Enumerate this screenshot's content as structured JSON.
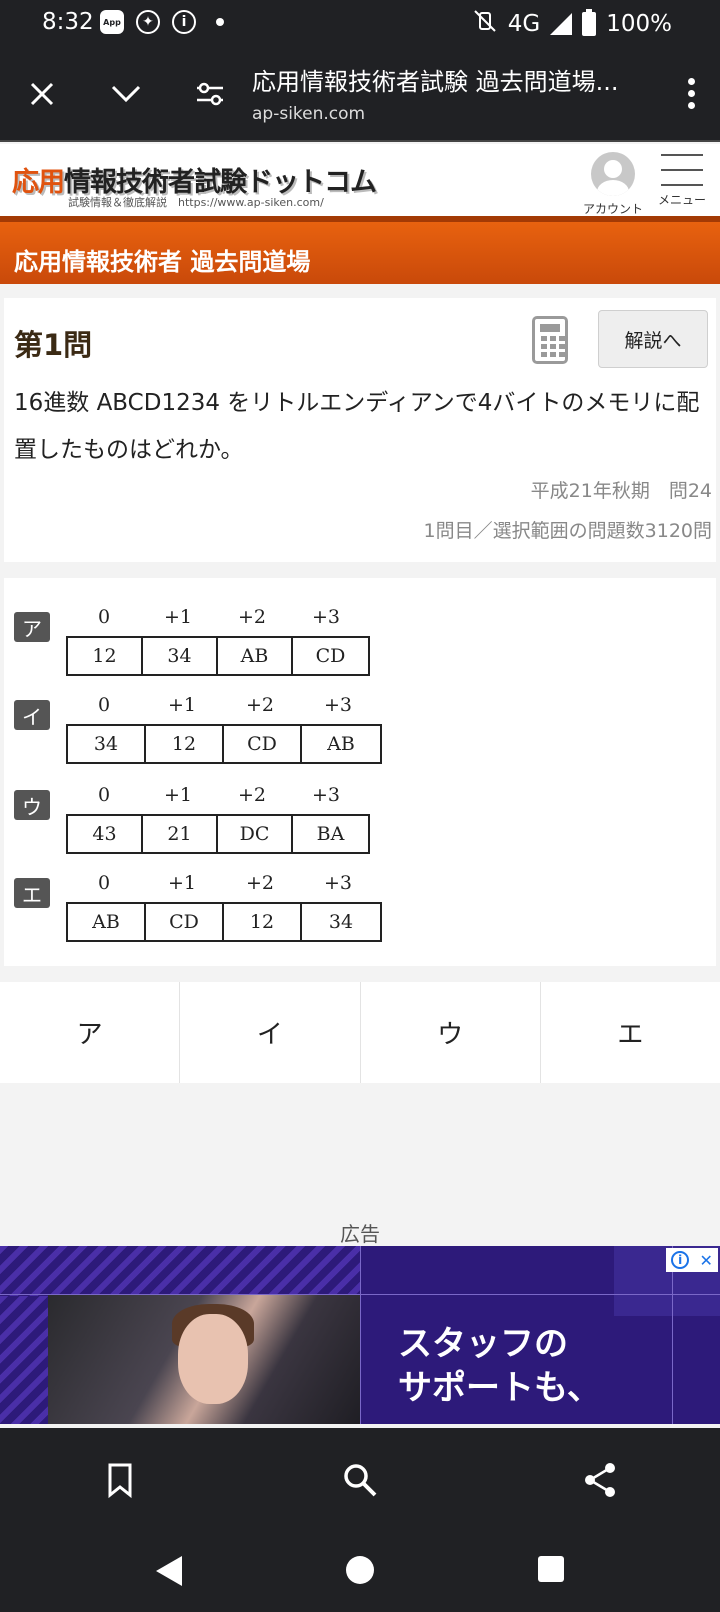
{
  "status_bar": {
    "time": "8:32",
    "app_badge": "App",
    "info_glyph": "i",
    "network": "4G",
    "battery": "100%",
    "icons": [
      "app-icon",
      "game-controller-icon",
      "info-icon",
      "notification-dot-icon",
      "vibrate-off-icon",
      "signal-icon",
      "battery-icon"
    ]
  },
  "browser": {
    "page_title": "応用情報技術者試験 過去問道場...",
    "url": "ap-siken.com",
    "icons": [
      "close-icon",
      "chevron-down-icon",
      "page-settings-icon",
      "more-vert-icon"
    ]
  },
  "site_header": {
    "logo_accent": "応用",
    "logo_rest": "情報技術者試験ドットコム",
    "logo_sub": "試験情報＆徹底解説　https://www.ap-siken.com/",
    "account_label": "アカウント",
    "menu_label": "メニュー"
  },
  "section_title": "応用情報技術者 過去問道場",
  "question": {
    "number": "第1問",
    "explain_button": "解説へ",
    "text": "16進数 ABCD1234 をリトルエンディアンで4バイトのメモリに配置したものはどれか。",
    "source": "平成21年秋期　問24",
    "progress": "1問目／選択範囲の問題数3120問"
  },
  "options": [
    {
      "label": "ア",
      "offsets": [
        "0",
        "+1",
        "+2",
        "+3"
      ],
      "cells": [
        "12",
        "34",
        "AB",
        "CD"
      ]
    },
    {
      "label": "イ",
      "offsets": [
        "0",
        "+1",
        "+2",
        "+3"
      ],
      "cells": [
        "34",
        "12",
        "CD",
        "AB"
      ]
    },
    {
      "label": "ウ",
      "offsets": [
        "0",
        "+1",
        "+2",
        "+3"
      ],
      "cells": [
        "43",
        "21",
        "DC",
        "BA"
      ]
    },
    {
      "label": "エ",
      "offsets": [
        "0",
        "+1",
        "+2",
        "+3"
      ],
      "cells": [
        "AB",
        "CD",
        "12",
        "34"
      ]
    }
  ],
  "answers": [
    "ア",
    "イ",
    "ウ",
    "エ"
  ],
  "ad": {
    "label": "広告",
    "copy_line1": "スタッフの",
    "copy_line2": "サポートも、",
    "info_glyph": "i",
    "close_glyph": "✕"
  },
  "bottom_bar": {
    "icons": [
      "bookmark-icon",
      "search-icon",
      "share-icon"
    ]
  },
  "nav_bar": {
    "icons": [
      "back-icon",
      "home-icon",
      "recents-icon"
    ]
  }
}
